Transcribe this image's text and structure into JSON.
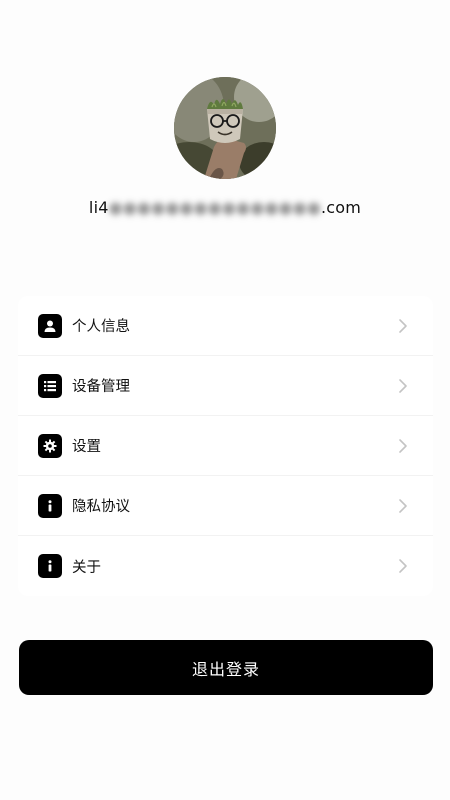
{
  "profile": {
    "email_prefix": "li4",
    "email_hidden": "●●●●●●●●●●●●●●●",
    "email_suffix": ".com"
  },
  "menu": {
    "items": [
      {
        "label": "个人信息",
        "icon": "user-icon"
      },
      {
        "label": "设备管理",
        "icon": "list-icon"
      },
      {
        "label": "设置",
        "icon": "gear-icon"
      },
      {
        "label": "隐私协议",
        "icon": "info-icon"
      },
      {
        "label": "关于",
        "icon": "info-icon"
      }
    ]
  },
  "logout": {
    "label": "退出登录"
  },
  "colors": {
    "background": "#fdfdfd",
    "button": "#000000",
    "icon_bg": "#000000",
    "chevron": "#c4c4c4"
  }
}
